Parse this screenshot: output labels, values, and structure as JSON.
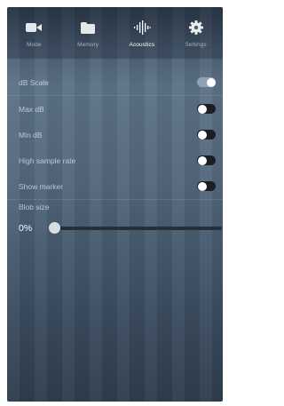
{
  "tabs": [
    {
      "label": "Mode",
      "icon": "video-camera-icon",
      "active": false
    },
    {
      "label": "Memory",
      "icon": "folder-icon",
      "active": false
    },
    {
      "label": "Acoustics",
      "icon": "waveform-icon",
      "active": true
    },
    {
      "label": "Settings",
      "icon": "gear-icon",
      "active": false
    }
  ],
  "settings": {
    "db_scale": {
      "label": "dB Scale",
      "on": true
    },
    "max_db": {
      "label": "Max dB",
      "on": false
    },
    "min_db": {
      "label": "Min dB",
      "on": false
    },
    "high_sample_rate": {
      "label": "High sample rate",
      "on": false
    },
    "show_marker": {
      "label": "Show marker",
      "on": false
    }
  },
  "blob_size": {
    "label": "Blob size",
    "value_text": "0%",
    "value": 0
  },
  "colors": {
    "toggle_on": "#8fa3b5",
    "toggle_off": "#1a1f24",
    "active_tab": "#ffffff"
  }
}
